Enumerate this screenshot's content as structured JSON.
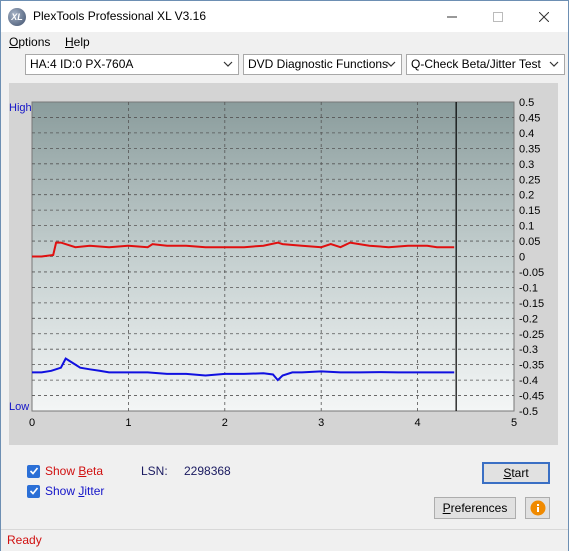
{
  "window": {
    "title": "PlexTools Professional XL V3.16",
    "icon_text": "XL",
    "status": "Ready"
  },
  "menu": {
    "items": [
      {
        "label": "Options",
        "mnemonic": "O",
        "rest": "ptions"
      },
      {
        "label": "Help",
        "mnemonic": "H",
        "rest": "elp"
      }
    ]
  },
  "toolbar": {
    "drive": "HA:4 ID:0  PX-760A",
    "function": "DVD Diagnostic Functions",
    "test": "Q-Check Beta/Jitter Test"
  },
  "chart_labels": {
    "high": "High",
    "low": "Low"
  },
  "controls": {
    "show_beta_prefix": "Show ",
    "show_beta_mnemonic": "B",
    "show_beta_rest": "eta",
    "show_beta_checked": true,
    "show_jitter_prefix": "Show ",
    "show_jitter_mnemonic": "J",
    "show_jitter_rest": "itter",
    "show_jitter_checked": true,
    "lsn_label": "LSN:",
    "lsn_value": "2298368",
    "start_mnemonic": "S",
    "start_rest": "tart",
    "preferences_prefix": "",
    "preferences_mnemonic": "P",
    "preferences_rest": "references",
    "info_icon": "info-icon"
  },
  "colors": {
    "beta": "#e01010",
    "jitter": "#1010e0",
    "label_blue": "#1414c8",
    "status_red": "#d01010"
  },
  "chart_data": {
    "type": "line",
    "title": "",
    "xlabel": "",
    "ylabel": "",
    "xlim": [
      0,
      5
    ],
    "ylim": [
      -0.5,
      0.5
    ],
    "x_ticks": [
      "0",
      "1",
      "2",
      "3",
      "4",
      "5"
    ],
    "y_ticks": [
      "0.5",
      "0.45",
      "0.4",
      "0.35",
      "0.3",
      "0.25",
      "0.2",
      "0.15",
      "0.1",
      "0.05",
      "0",
      "-0.05",
      "-0.1",
      "-0.15",
      "-0.2",
      "-0.25",
      "-0.3",
      "-0.35",
      "-0.4",
      "-0.45",
      "-0.5"
    ],
    "grid": true,
    "end_marker_x": 4.4,
    "series": [
      {
        "key": "beta",
        "x": [
          0,
          0.1,
          0.22,
          0.25,
          0.3,
          0.45,
          0.6,
          0.8,
          1.0,
          1.2,
          1.25,
          1.4,
          1.6,
          1.8,
          2.0,
          2.2,
          2.4,
          2.55,
          2.6,
          2.8,
          3.0,
          3.1,
          3.2,
          3.3,
          3.5,
          3.7,
          3.9,
          4.1,
          4.2,
          4.38
        ],
        "y": [
          0.0,
          0.0,
          0.005,
          0.045,
          0.045,
          0.03,
          0.035,
          0.03,
          0.035,
          0.03,
          0.04,
          0.035,
          0.035,
          0.03,
          0.03,
          0.03,
          0.035,
          0.045,
          0.04,
          0.035,
          0.03,
          0.04,
          0.03,
          0.045,
          0.035,
          0.03,
          0.035,
          0.035,
          0.03,
          0.03
        ]
      },
      {
        "key": "jitter",
        "x": [
          0,
          0.1,
          0.2,
          0.3,
          0.35,
          0.4,
          0.45,
          0.5,
          0.6,
          0.7,
          0.8,
          1.0,
          1.2,
          1.4,
          1.6,
          1.8,
          2.0,
          2.2,
          2.4,
          2.5,
          2.55,
          2.6,
          2.7,
          2.8,
          3.0,
          3.2,
          3.4,
          3.6,
          3.8,
          4.0,
          4.2,
          4.38
        ],
        "y": [
          -0.375,
          -0.375,
          -0.37,
          -0.36,
          -0.33,
          -0.34,
          -0.35,
          -0.36,
          -0.365,
          -0.37,
          -0.375,
          -0.375,
          -0.375,
          -0.38,
          -0.38,
          -0.385,
          -0.38,
          -0.38,
          -0.378,
          -0.382,
          -0.4,
          -0.385,
          -0.375,
          -0.375,
          -0.372,
          -0.375,
          -0.375,
          -0.374,
          -0.375,
          -0.375,
          -0.375,
          -0.375
        ]
      }
    ]
  }
}
